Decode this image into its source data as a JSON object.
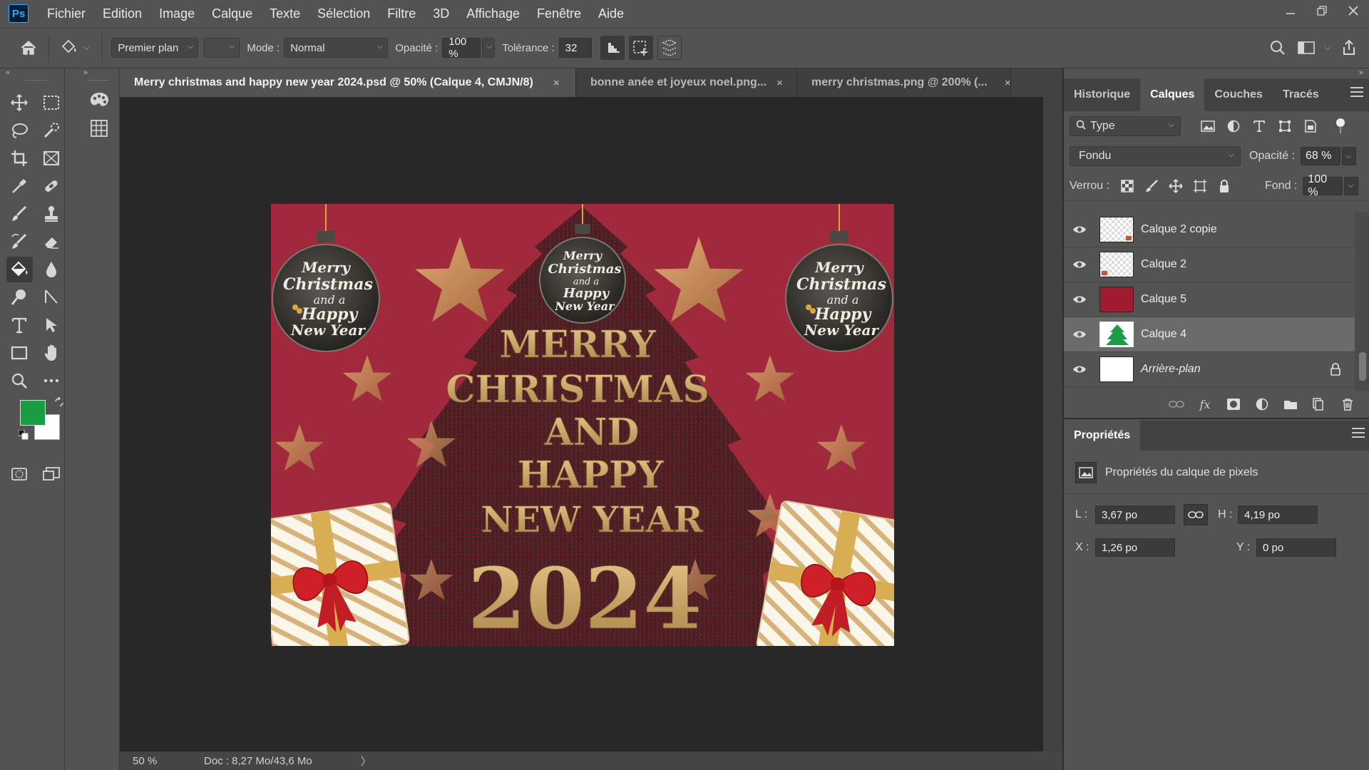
{
  "app": {
    "logo": "Ps"
  },
  "menu": [
    "Fichier",
    "Edition",
    "Image",
    "Calque",
    "Texte",
    "Sélection",
    "Filtre",
    "3D",
    "Affichage",
    "Fenêtre",
    "Aide"
  ],
  "options": {
    "fill_source": "Premier plan",
    "mode_label": "Mode :",
    "mode_value": "Normal",
    "opacity_label": "Opacité :",
    "opacity_value": "100 %",
    "tolerance_label": "Tolérance :",
    "tolerance_value": "32"
  },
  "colors": {
    "foreground": "#1a9c44",
    "background": "#ffffff"
  },
  "tabs": [
    {
      "label": "Merry christmas and happy new year 2024.psd @ 50% (Calque 4, CMJN/8)",
      "active": true
    },
    {
      "label": "bonne anée et joyeux noel.png...",
      "active": false
    },
    {
      "label": "merry christmas.png @ 200% (...",
      "active": false
    }
  ],
  "tab_close": "×",
  "artwork": {
    "headline_lines": [
      "MERRY",
      "CHRISTMAS",
      "AND",
      "HAPPY",
      "NEW YEAR"
    ],
    "year": "2024",
    "ornament_lines": [
      "Merry",
      "Christmas",
      "and a",
      "Happy",
      "New Year"
    ]
  },
  "status": {
    "zoom": "50 %",
    "doc": "Doc : 8,27 Mo/43,6 Mo",
    "arrow": "〉"
  },
  "layers_panel": {
    "tabs": [
      "Historique",
      "Calques",
      "Couches",
      "Tracés"
    ],
    "active_tab": "Calques",
    "filter_type": "Type",
    "blend_mode": "Fondu",
    "opacity_label": "Opacité :",
    "opacity_value": "68 %",
    "lock_label": "Verrou :",
    "fill_label": "Fond :",
    "fill_value": "100 %",
    "layers": [
      {
        "name": "Calque 2 copie",
        "thumb": "checker",
        "selected": false,
        "italic": false
      },
      {
        "name": "Calque 2",
        "thumb": "checker",
        "selected": false,
        "italic": false
      },
      {
        "name": "Calque 5",
        "thumb": "red",
        "selected": false,
        "italic": false
      },
      {
        "name": "Calque 4",
        "thumb": "tree",
        "selected": true,
        "italic": false
      },
      {
        "name": "Arrière-plan",
        "thumb": "white",
        "selected": false,
        "italic": true
      }
    ]
  },
  "properties_panel": {
    "title": "Propriétés",
    "subtitle": "Propriétés du calque de pixels",
    "w_label": "L :",
    "w_value": "3,67 po",
    "h_label": "H :",
    "h_value": "4,19 po",
    "x_label": "X :",
    "x_value": "1,26 po",
    "y_label": "Y :",
    "y_value": "0 po"
  }
}
